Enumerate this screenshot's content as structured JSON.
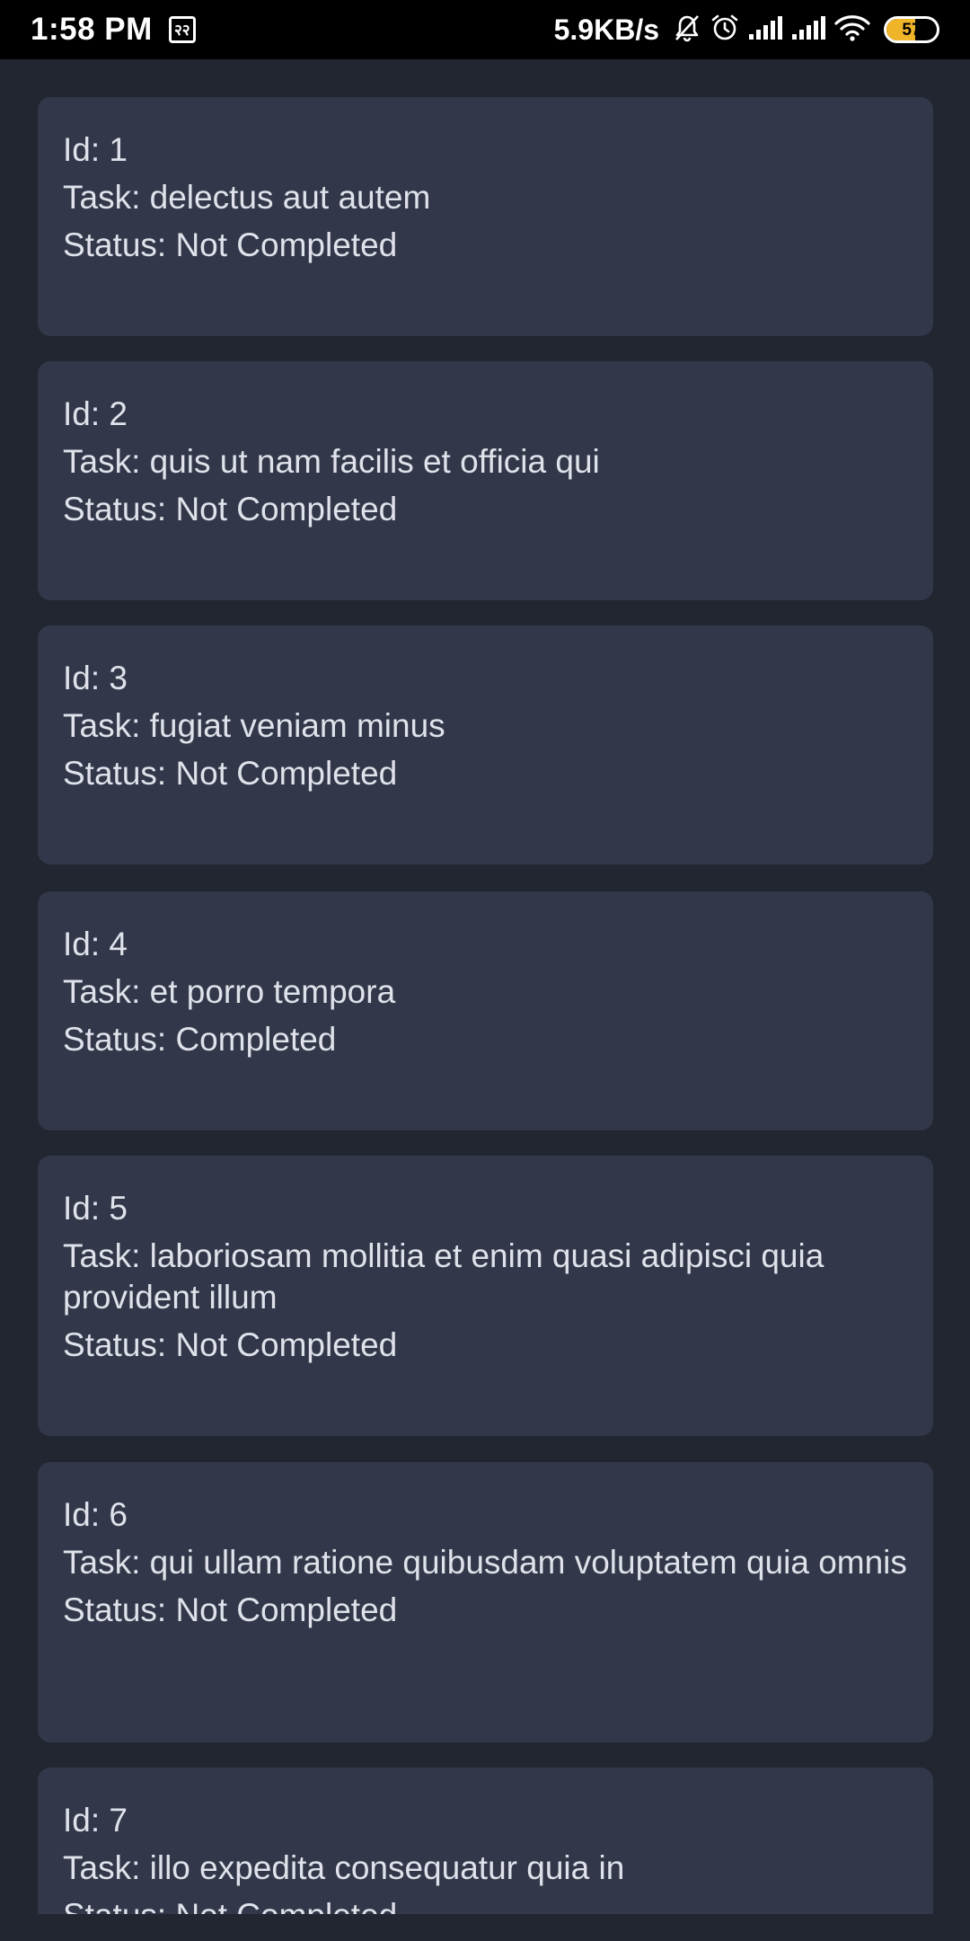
{
  "status_bar": {
    "time": "1:58 PM",
    "app_icon_text": "२२",
    "network_speed": "5.9KB/s",
    "battery_level": "57",
    "battery_fraction": 0.57,
    "battery_color": "#f0b429",
    "icons": [
      "bell-off-icon",
      "alarm-icon",
      "signal-icon",
      "signal-icon",
      "wifi-icon",
      "battery-icon"
    ]
  },
  "tasks": [
    {
      "id": "Id: 1",
      "task": "Task: delectus aut autem",
      "status": "Status: Not Completed"
    },
    {
      "id": "Id: 2",
      "task": "Task: quis ut nam facilis et officia qui",
      "status": "Status: Not Completed"
    },
    {
      "id": "Id: 3",
      "task": "Task: fugiat veniam minus",
      "status": "Status: Not Completed"
    },
    {
      "id": "Id: 4",
      "task": "Task: et porro tempora",
      "status": "Status: Completed"
    },
    {
      "id": "Id: 5",
      "task": "Task: laboriosam mollitia et enim quasi adipisci quia provident illum",
      "status": "Status: Not Completed"
    },
    {
      "id": "Id: 6",
      "task": "Task: qui ullam ratione quibusdam voluptatem quia omnis",
      "status": "Status: Not Completed"
    },
    {
      "id": "Id: 7",
      "task": "Task: illo expedita consequatur quia in",
      "status": "Status: Not Completed"
    }
  ],
  "colors": {
    "background": "#222630",
    "card": "#323849",
    "text": "#dfe2ea"
  }
}
